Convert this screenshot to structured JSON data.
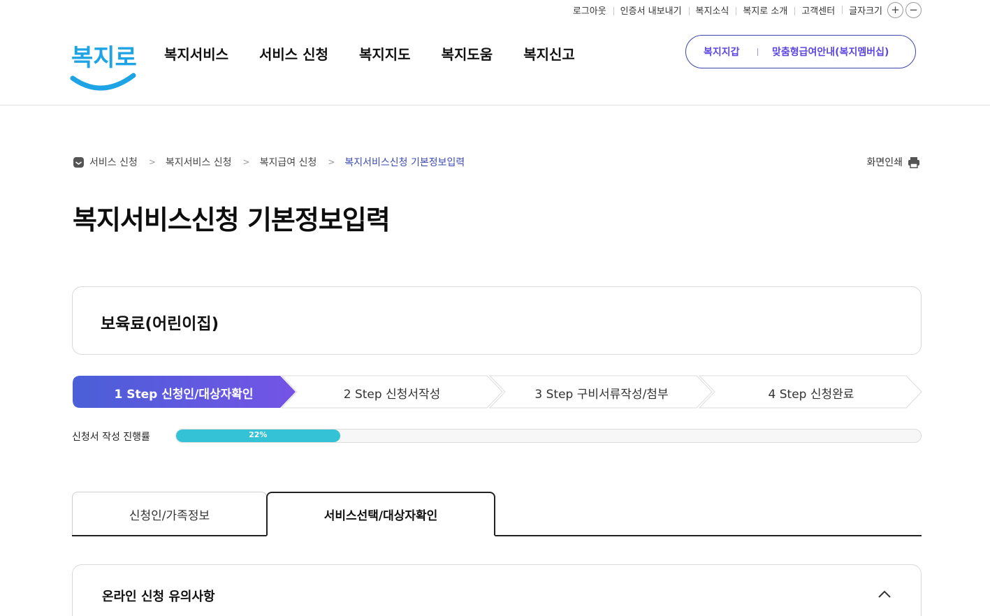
{
  "utility": {
    "items": [
      "로그아웃",
      "인증서 내보내기",
      "복지소식",
      "복지로 소개",
      "고객센터"
    ],
    "font_size_label": "글자크기",
    "increase": "+",
    "decrease": "−"
  },
  "logo": {
    "text": "복지로"
  },
  "gnb": {
    "items": [
      "복지서비스",
      "서비스 신청",
      "복지지도",
      "복지도움",
      "복지신고"
    ]
  },
  "header_pill": {
    "left": "복지지갑",
    "right": "맞춤형급여안내(복지멤버십)"
  },
  "breadcrumb": {
    "items": [
      "서비스 신청",
      "복지서비스 신청",
      "복지급여 신청"
    ],
    "current": "복지서비스신청 기본정보입력"
  },
  "print_label": "화면인쇄",
  "page_title": "복지서비스신청 기본정보입력",
  "service_name": "보육료(어린이집)",
  "steps": [
    {
      "label": "1 Step 신청인/대상자확인",
      "active": true
    },
    {
      "label": "2 Step 신청서작성",
      "active": false
    },
    {
      "label": "3 Step 구비서류작성/첨부",
      "active": false
    },
    {
      "label": "4 Step 신청완료",
      "active": false
    }
  ],
  "progress": {
    "label": "신청서 작성 진행률",
    "value": 22,
    "text": "22%"
  },
  "tabs": [
    {
      "label": "신청인/가족정보",
      "selected": false
    },
    {
      "label": "서비스선택/대상자확인",
      "selected": true
    }
  ],
  "accordion": {
    "title": "온라인 신청 유의사항",
    "expanded": true
  },
  "colors": {
    "accent": "#5b46e0",
    "step_gradient_start": "#4a5fd8",
    "step_gradient_end": "#7454e6",
    "progress": "#34c3d6",
    "logo_blue": "#1ea3e4"
  },
  "icons": {
    "home": "home-icon",
    "chevron": "chevron-right-icon",
    "print": "printer-icon",
    "collapse": "chevron-up-icon"
  }
}
